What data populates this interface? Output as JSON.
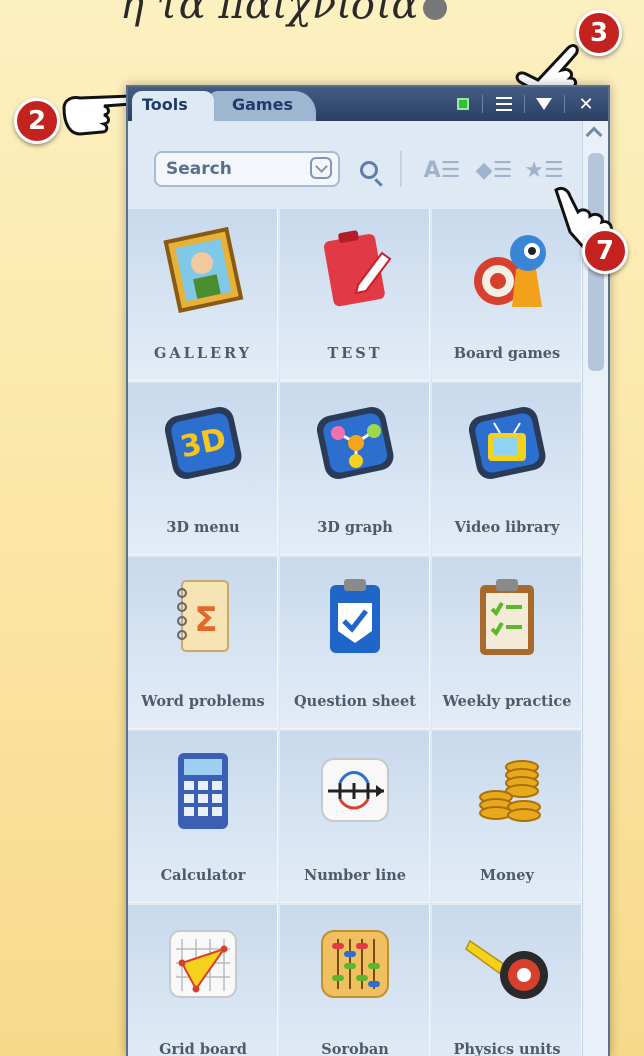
{
  "heading": {
    "text": "ή τα παιχνίδια"
  },
  "callouts": [
    "2",
    "3",
    "7"
  ],
  "tabs": [
    {
      "label": "Tools",
      "active": true
    },
    {
      "label": "Games",
      "active": false
    }
  ],
  "titlebar_icons": [
    "green-square-icon",
    "list-icon",
    "dropdown-triangle-icon",
    "close-icon"
  ],
  "close_label": "✕",
  "search": {
    "placeholder": "Search"
  },
  "toolbar_icons": [
    "search-magnifier-icon",
    "sort-alpha-icon",
    "sort-diamond-icon",
    "favorites-star-icon"
  ],
  "sort_alpha_label": "A☰",
  "sort_diamond_label": "◆☰",
  "favorites_label": "★☰",
  "items": [
    {
      "label": "GALLERY",
      "icon": "gallery-portrait-icon"
    },
    {
      "label": "TEST",
      "icon": "test-clipboard-pen-icon"
    },
    {
      "label": "Board games",
      "icon": "board-games-target-icon"
    },
    {
      "label": "3D menu",
      "icon": "3d-menu-icon"
    },
    {
      "label": "3D graph",
      "icon": "3d-graph-icon"
    },
    {
      "label": "Video library",
      "icon": "video-library-tv-icon"
    },
    {
      "label": "Word problems",
      "icon": "word-problems-notebook-icon"
    },
    {
      "label": "Question sheet",
      "icon": "question-sheet-clipboard-icon"
    },
    {
      "label": "Weekly practice",
      "icon": "weekly-practice-checklist-icon"
    },
    {
      "label": "Calculator",
      "icon": "calculator-icon"
    },
    {
      "label": "Number line",
      "icon": "number-line-icon"
    },
    {
      "label": "Money",
      "icon": "money-coins-icon"
    },
    {
      "label": "Grid board",
      "icon": "grid-board-triangle-icon"
    },
    {
      "label": "Soroban",
      "icon": "soroban-abacus-icon"
    },
    {
      "label": "Physics units",
      "icon": "physics-units-tape-measure-icon"
    }
  ],
  "colors": {
    "titlebar": "#2b3f63",
    "panel": "#dfe9f4",
    "callout": "#c4221f",
    "background": "#fbe6a6"
  }
}
